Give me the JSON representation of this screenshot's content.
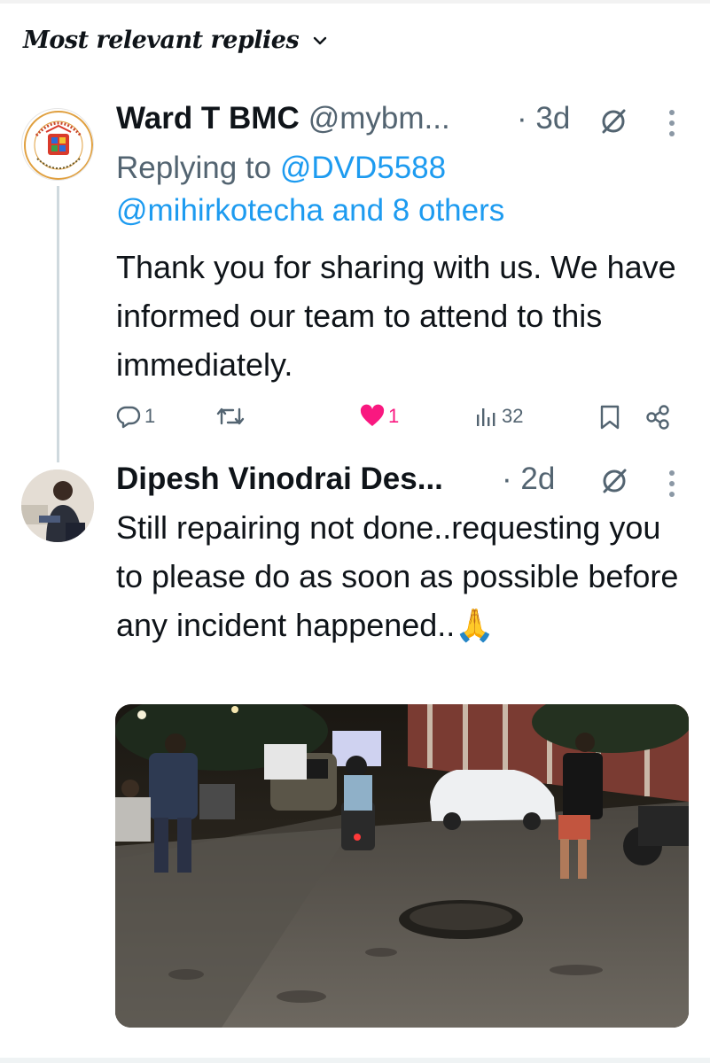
{
  "header": {
    "title": "Most relevant replies",
    "icon": "chevron-down-icon"
  },
  "tweets": [
    {
      "name": "Ward T BMC",
      "handle": "@mybm...",
      "time": "· 3d",
      "replying_prefix": "Replying to ",
      "replying_to_1": "@DVD5588",
      "replying_to_2": "@mihirkotecha and 8 others",
      "text": "Thank you for sharing with us. We have informed our team to attend to this immediately.",
      "replies": "1",
      "likes": "1",
      "views": "32"
    },
    {
      "name": "Dipesh Vinodrai Des...",
      "time": "· 2d",
      "text": "Still repairing not done..requesting you to please do as soon as possible before any incident happened..🙏"
    }
  ],
  "colors": {
    "link": "#1d9bf0",
    "like": "#f91880",
    "muted": "#536471"
  }
}
